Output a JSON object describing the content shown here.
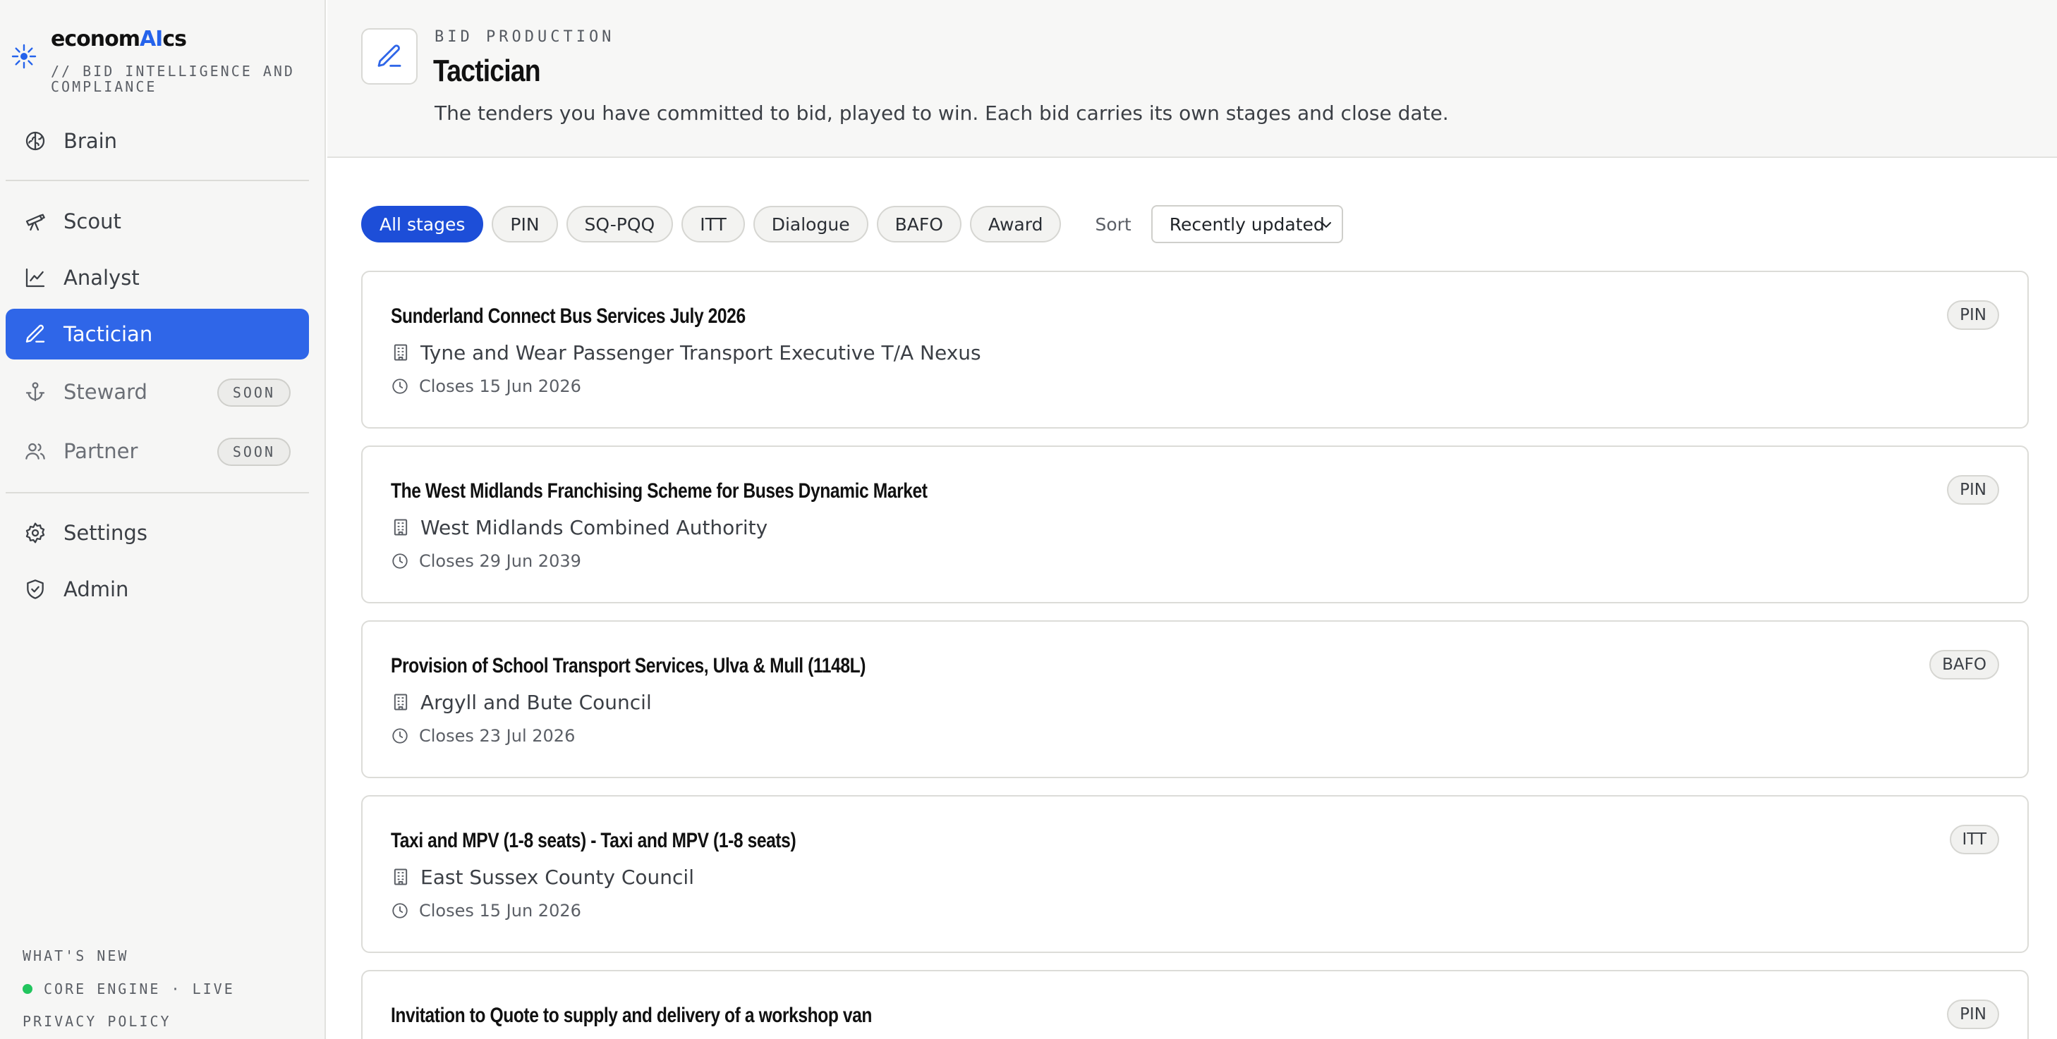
{
  "brand": {
    "name_prefix": "econom",
    "name_ai": "AI",
    "name_suffix": "cs",
    "tagline": "// BID INTELLIGENCE AND COMPLIANCE"
  },
  "sidebar": {
    "items": [
      {
        "label": "Brain",
        "icon": "brain-icon"
      },
      {
        "label": "Scout",
        "icon": "telescope-icon"
      },
      {
        "label": "Analyst",
        "icon": "line-chart-icon"
      },
      {
        "label": "Tactician",
        "icon": "pen-icon",
        "active": true
      },
      {
        "label": "Steward",
        "icon": "anchor-icon",
        "badge": "SOON"
      },
      {
        "label": "Partner",
        "icon": "users-icon",
        "badge": "SOON"
      },
      {
        "label": "Settings",
        "icon": "gear-icon"
      },
      {
        "label": "Admin",
        "icon": "shield-check-icon"
      }
    ],
    "footer": {
      "whats_new": "WHAT'S NEW",
      "status": "CORE ENGINE · LIVE",
      "privacy": "PRIVACY POLICY"
    }
  },
  "header": {
    "eyebrow": "BID PRODUCTION",
    "title": "Tactician",
    "subtitle": "The tenders you have committed to bid, played to win. Each bid carries its own stages and close date."
  },
  "filters": {
    "chips": [
      "All stages",
      "PIN",
      "SQ-PQQ",
      "ITT",
      "Dialogue",
      "BAFO",
      "Award"
    ],
    "active_index": 0,
    "sort_label": "Sort",
    "sort_value": "Recently updated"
  },
  "bids": [
    {
      "title": "Sunderland Connect Bus Services July 2026",
      "buyer": "Tyne and Wear Passenger Transport Executive T/A Nexus",
      "closes": "Closes 15 Jun 2026",
      "stage": "PIN"
    },
    {
      "title": "The West Midlands Franchising Scheme for Buses Dynamic Market",
      "buyer": "West Midlands Combined Authority",
      "closes": "Closes 29 Jun 2039",
      "stage": "PIN"
    },
    {
      "title": "Provision of School Transport Services, Ulva & Mull (1148L)",
      "buyer": "Argyll and Bute Council",
      "closes": "Closes 23 Jul 2026",
      "stage": "BAFO"
    },
    {
      "title": "Taxi and MPV (1-8 seats) - Taxi and MPV (1-8 seats)",
      "buyer": "East Sussex County Council",
      "closes": "Closes 15 Jun 2026",
      "stage": "ITT"
    },
    {
      "title": "Invitation to Quote to supply and delivery of a workshop van",
      "buyer": "",
      "closes": "",
      "stage": "PIN"
    }
  ],
  "colors": {
    "accent": "#2f66e8",
    "chip_active": "#1d4ed8",
    "live": "#22c55e"
  }
}
